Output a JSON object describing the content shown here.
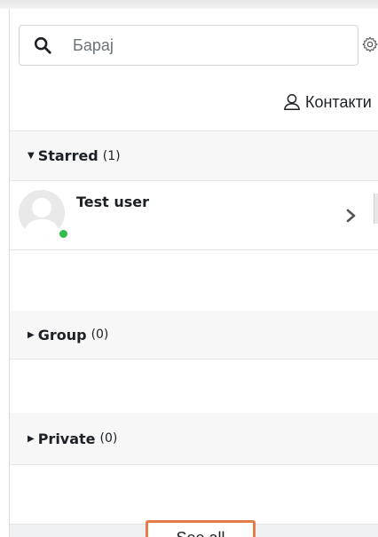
{
  "search": {
    "placeholder": "Барај",
    "icon": "search-icon"
  },
  "settings": {
    "icon": "gear-icon"
  },
  "contacts_link": {
    "label": "Контакти",
    "icon": "user-icon"
  },
  "sections": {
    "starred": {
      "label": "Starred",
      "count": "(1)",
      "expanded": true,
      "contacts": [
        {
          "name": "Test user",
          "online": true
        }
      ]
    },
    "group": {
      "label": "Group",
      "count": "(0)",
      "expanded": false
    },
    "private": {
      "label": "Private",
      "count": "(0)",
      "expanded": false
    }
  },
  "footer": {
    "see_all_label": "See all"
  },
  "colors": {
    "online": "#2ebd4a",
    "highlight": "#e47c4a",
    "header_bg": "#f7f7f8"
  }
}
